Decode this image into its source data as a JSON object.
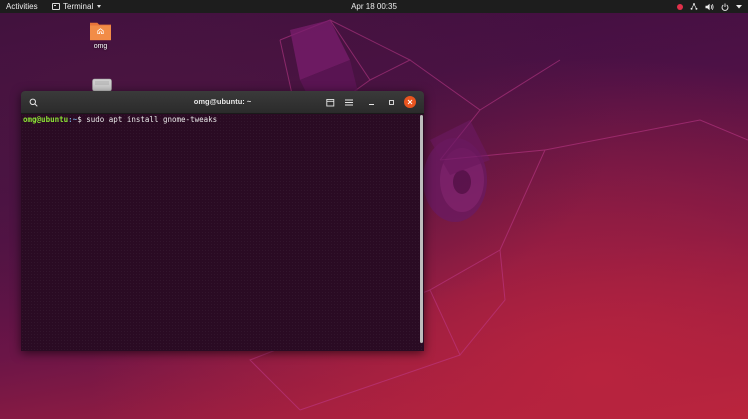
{
  "topbar": {
    "activities": "Activities",
    "app_menu": "Terminal",
    "clock": "Apr 18  00:35"
  },
  "desktop": {
    "icons": [
      {
        "label": "omg",
        "icon": "home-folder-icon"
      },
      {
        "label": "",
        "icon": "drive-icon"
      }
    ]
  },
  "terminal": {
    "title": "omg@ubuntu: ~",
    "prompt_user": "omg@ubuntu",
    "prompt_path": ":~",
    "prompt_symbol": "$",
    "command": " sudo apt install gnome-tweaks"
  },
  "colors": {
    "close_button": "#e9541f",
    "prompt_user": "#8ae234",
    "prompt_path": "#729fcf",
    "terminal_bg": "#2a0b23"
  }
}
